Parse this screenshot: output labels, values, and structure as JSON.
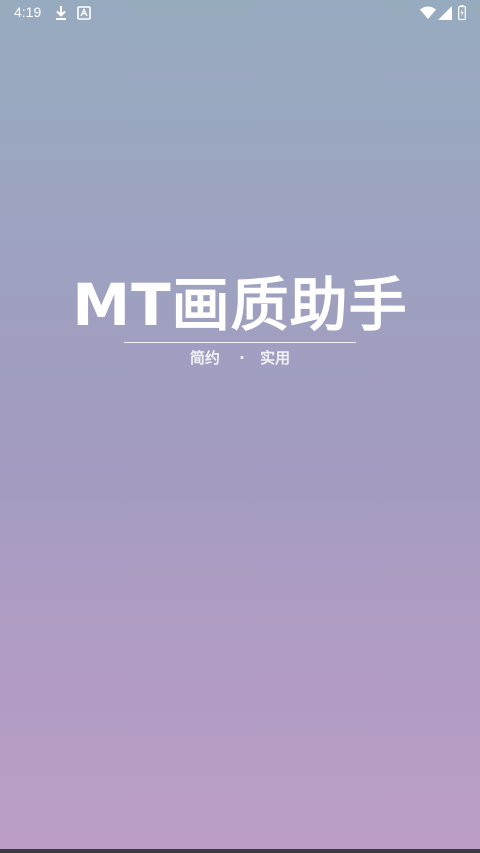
{
  "status_bar": {
    "time": "4:19",
    "icons": [
      "download-icon",
      "keyboard-icon",
      "wifi-icon",
      "signal-icon",
      "battery-icon"
    ]
  },
  "splash": {
    "title": "MT画质助手",
    "tagline_left": "简约",
    "tagline_dot": "·",
    "tagline_right": "实用"
  },
  "colors": {
    "gradient_top": "#97abbf",
    "gradient_mid": "#a29cc1",
    "gradient_bottom": "#bc9dc5",
    "text": "#ffffff"
  }
}
